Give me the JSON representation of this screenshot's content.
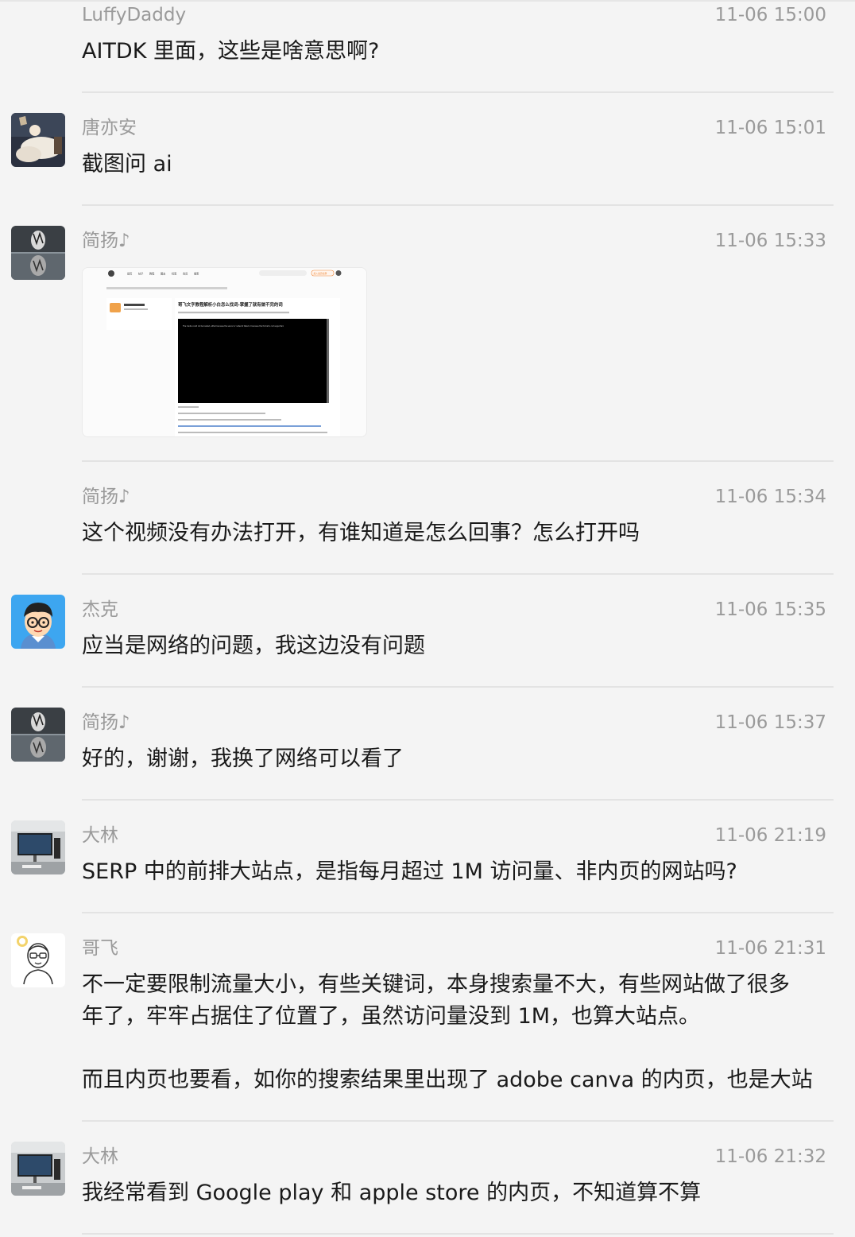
{
  "messages": [
    {
      "name": "LuffyDaddy",
      "time": "11-06 15:00",
      "text": [
        "AITDK 里面，这些是啥意思啊?"
      ]
    },
    {
      "name": "唐亦安",
      "time": "11-06 15:01",
      "text": [
        "截图问 ai"
      ]
    },
    {
      "name": "简扬♪",
      "time": "11-06 15:33",
      "image": {
        "site_title": "哥飞文字教程解析小白怎么找词-掌握了就有做不完的词",
        "nav_items": [
          "首页",
          "帖子",
          "教程",
          "圈友",
          "标签",
          "会员",
          "搜索"
        ],
        "cta_label": "加入会员社群",
        "video_message": "The media could not be loaded, either because the server or network failed or because the format is not supported."
      }
    },
    {
      "name": "简扬♪",
      "time": "11-06 15:34",
      "text": [
        "这个视频没有办法打开，有谁知道是怎么回事？怎么打开吗"
      ]
    },
    {
      "name": "杰克",
      "time": "11-06 15:35",
      "text": [
        "应当是网络的问题，我这边没有问题"
      ]
    },
    {
      "name": "简扬♪",
      "time": "11-06 15:37",
      "text": [
        "好的，谢谢，我换了网络可以看了"
      ]
    },
    {
      "name": "大林",
      "time": "11-06 21:19",
      "text": [
        "SERP 中的前排大站点，是指每月超过 1M 访问量、非内页的网站吗?"
      ]
    },
    {
      "name": "哥飞",
      "time": "11-06 21:31",
      "text": [
        "不一定要限制流量大小，有些关键词，本身搜索量不大，有些网站做了很多",
        "年了，牢牢占据住了位置了，虽然访问量没到 1M，也算大站点。",
        "",
        "而且内页也要看，如你的搜索结果里出现了 adobe canva 的内页，也是大站"
      ]
    },
    {
      "name": "大林",
      "time": "11-06 21:32",
      "text": [
        "我经常看到 Google play 和 apple store 的内页，不知道算不算"
      ]
    }
  ],
  "avatars": [
    "none",
    "person-on-couch",
    "tiger-reflection",
    "none",
    "cartoon-boy-glasses",
    "tiger-reflection",
    "desk-monitor",
    "doodle-man-glasses",
    "desk-monitor"
  ],
  "colors": {
    "background": "#f4f4f4",
    "meta_text": "#9a9a9a",
    "body_text": "#1a1a1a",
    "divider": "#e3e3e3"
  }
}
